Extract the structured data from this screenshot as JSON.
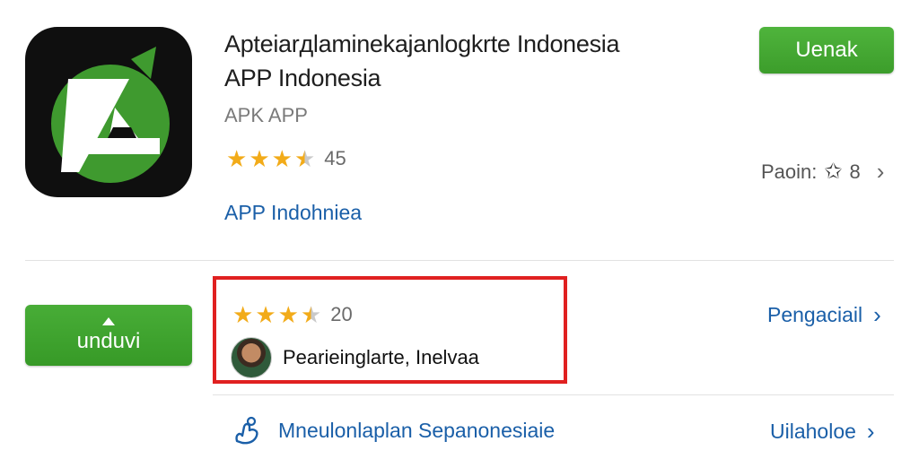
{
  "app": {
    "title_line1": "Apteiarдlaminekajanlogkrte Indonesia",
    "title_line2": "APP Indonesia",
    "developer": "APK APP",
    "rating_stars": 3.5,
    "rating_count": "45",
    "category_link": "APP Indohniea",
    "install_label": "Uenak",
    "page_label": "Paoin:",
    "page_number": "8"
  },
  "download": {
    "button_label": "unduvi"
  },
  "review": {
    "rating_stars": 3.5,
    "rating_count": "20",
    "reviewer_name": "Pearieinglarte, Inelvaa",
    "details_link": "Pengaciail"
  },
  "footer": {
    "permission_text": "Mneulonlaplan Sepanonesiaie",
    "more_link": "Uilaholoe"
  },
  "colors": {
    "accent_green": "#3c9d2b",
    "link_blue": "#1a5fa8",
    "star_gold": "#f2ab19",
    "highlight_red": "#e02020"
  }
}
